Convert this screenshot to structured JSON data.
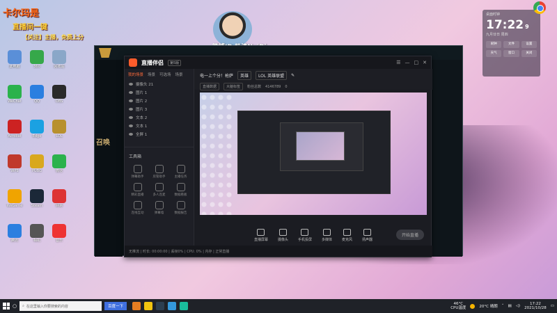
{
  "overlay": {
    "line1": "卡尔玛是",
    "line2": "直播间一键",
    "line3": "【关注】主播，免费上分"
  },
  "cam": {
    "watermark": "微博ID:奶渣NaiDi"
  },
  "desktop_icons": [
    {
      "label": "此电脑",
      "color": "#5a8fd8"
    },
    {
      "label": "360",
      "color": "#36a84a"
    },
    {
      "label": "回收站",
      "color": "#8aa7c8"
    },
    {
      "label": "WeChat",
      "color": "#2bb24c"
    },
    {
      "label": "QQ",
      "color": "#2b7fe0"
    },
    {
      "label": "OBS",
      "color": "#2a2a2a"
    },
    {
      "label": "Acrobat",
      "color": "#c22"
    },
    {
      "label": "Edge",
      "color": "#1ba1e2"
    },
    {
      "label": "LOL",
      "color": "#b8902e"
    },
    {
      "label": "WPS",
      "color": "#c0392b"
    },
    {
      "label": "PUBG",
      "color": "#d9a81e"
    },
    {
      "label": "微信",
      "color": "#2bb24c"
    },
    {
      "label": "WeGame",
      "color": "#f0a400"
    },
    {
      "label": "Steam",
      "color": "#1b2838"
    },
    {
      "label": "网易",
      "color": "#d33"
    },
    {
      "label": "腾讯",
      "color": "#2b7fe0"
    },
    {
      "label": "相机",
      "color": "#555"
    },
    {
      "label": "音乐",
      "color": "#e33"
    }
  ],
  "lol": {
    "summoner_text": "召唤"
  },
  "stream_app": {
    "name": "直播伴侣",
    "badge": "第5版",
    "tabs": [
      "我的场景",
      "场景",
      "可选场",
      "场景"
    ],
    "layers": [
      "摄像头 21",
      "图片 1",
      "图片 2",
      "图片 3",
      "文本 2",
      "文本 1",
      "全屏 1"
    ],
    "tools_title": "工具箱",
    "tools": [
      "弹幕助手",
      "房管助手",
      "主播任务",
      "精彩直播",
      "多人连麦",
      "数据看板",
      "连线互动",
      "弹幕墙",
      "数据报告"
    ],
    "head_title": "电一上个分！枪萨",
    "head_pill1": "英雄",
    "head_pill2": "LOL 英雄联盟",
    "head_row2": [
      "直播数据",
      "大脑标签",
      "粉丝总数",
      "4146789",
      "0"
    ],
    "bottom_buttons": [
      "直播屏幕",
      "摄像头",
      "手机投屏",
      "多媒体",
      "麦克风",
      "扬声器"
    ],
    "go_live": "开始直播",
    "status": "无推流 | 时长: 00:00:00 | 丢帧0% | CPU: 0% | 内存 | 正常直播"
  },
  "clock": {
    "title": "桌面时钟",
    "time": "17:22",
    "seconds": "9",
    "date": "九月廿日 周四",
    "buttons": [
      "闹钟",
      "文件",
      "设置",
      "天气",
      "窗口",
      "关闭"
    ]
  },
  "taskbar": {
    "search_placeholder": "在这里输入你要搜索的内容",
    "baidu_button": "百度一下",
    "cpu_temp": "46°C",
    "cpu_label": "CPU温度",
    "weather": "20°C 晴朗",
    "time": "17:22",
    "date": "2021/10/28",
    "app_colors": [
      "#e67e22",
      "#f1c40f",
      "#2c3e50",
      "#3498db",
      "#1abc9c"
    ]
  }
}
